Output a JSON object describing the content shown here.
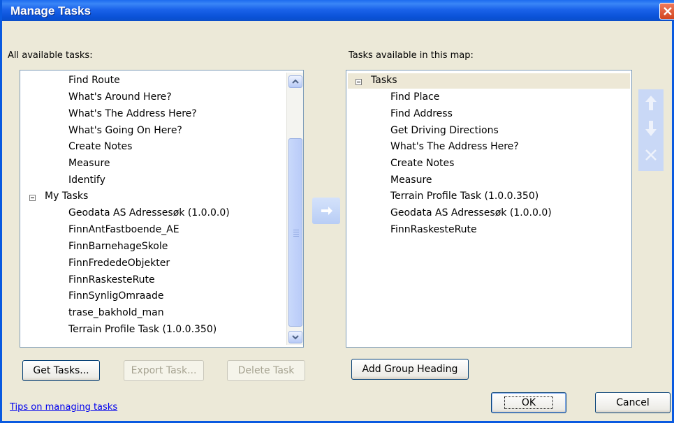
{
  "window": {
    "title": "Manage Tasks"
  },
  "left_panel": {
    "label": "All available tasks:",
    "items": [
      "Find Route",
      "What's Around Here?",
      "What's The Address Here?",
      "What's Going On Here?",
      "Create Notes",
      "Measure",
      "Identify"
    ],
    "group": "My Tasks",
    "group_items": [
      "Geodata AS Adressesøk (1.0.0.0)",
      "FinnAntFastboende_AE",
      "FinnBarnehageSkole",
      "FinnFrededeObjekter",
      "FinnRaskesteRute",
      "FinnSynligOmraade",
      "trase_bakhold_man",
      "Terrain Profile Task (1.0.0.350)"
    ]
  },
  "right_panel": {
    "label": "Tasks available in this map:",
    "group": "Tasks",
    "items": [
      "Find Place",
      "Find Address",
      "Get Driving Directions",
      "What's The Address Here?",
      "Create Notes",
      "Measure",
      "Terrain Profile Task (1.0.0.350)",
      "Geodata AS Adressesøk (1.0.0.0)",
      "FinnRaskesteRute"
    ]
  },
  "buttons": {
    "get_tasks": "Get Tasks...",
    "export_task": "Export Task...",
    "delete_task": "Delete Task",
    "add_group_heading": "Add Group Heading",
    "ok": "OK",
    "cancel": "Cancel"
  },
  "icons": {
    "add": "arrow-right-icon",
    "move_up": "arrow-up-icon",
    "move_down": "arrow-down-icon",
    "remove": "x-icon",
    "close": "close-icon"
  },
  "link": {
    "tips": "Tips on managing tasks"
  },
  "colors": {
    "titlebar": "#0a52d8",
    "dialog_bg": "#ece9d8",
    "selection": "#ede8d6",
    "link": "#0000ee"
  }
}
